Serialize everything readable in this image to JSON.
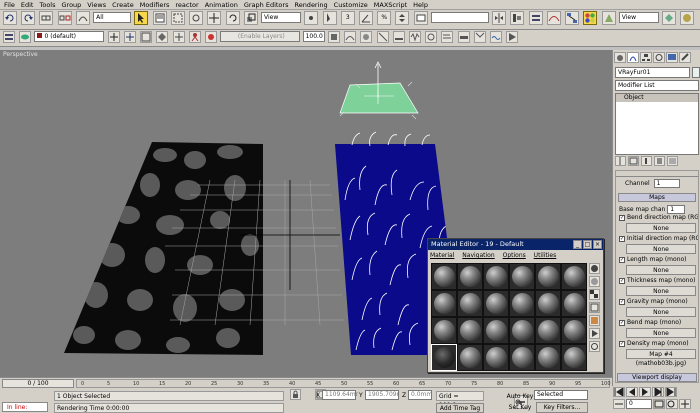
{
  "menu": [
    "File",
    "Edit",
    "Tools",
    "Group",
    "Views",
    "Create",
    "Modifiers",
    "reactor",
    "Animation",
    "Graph Editors",
    "Rendering",
    "Customize",
    "MAXScript",
    "Help"
  ],
  "toolbar": {
    "selection_filter": "All",
    "ref_coord": "View",
    "named_sel": "",
    "snap_view": "View",
    "layer": "0 (default)",
    "enable_layers": "(Enable Layers)",
    "percent": "100.0"
  },
  "viewport": {
    "label": "Perspective"
  },
  "colors": {
    "viewport_bg": "#7d7d7d",
    "blue_plane": "#0a0a8a",
    "gizmo": "#7fd19a",
    "active_yellow": "#f6d84a"
  },
  "material_editor": {
    "title": "Material Editor - 19 - Default",
    "menu": [
      "Material",
      "Navigation",
      "Options",
      "Utilities"
    ]
  },
  "command_panel": {
    "object_name": "VRayFur01",
    "modifier_list": "Modifier List",
    "stack_item": "Object",
    "channel_label": "Channel",
    "channel_value": "1",
    "maps_header": "Maps",
    "base_map_label": "Base map chan",
    "base_map_value": "1",
    "maps": [
      {
        "label": "Bend direction map (RGB)",
        "value": "None",
        "checked": true
      },
      {
        "label": "Initial direction map (RGB)",
        "value": "None",
        "checked": true
      },
      {
        "label": "Length map (mono)",
        "value": "None",
        "checked": true
      },
      {
        "label": "Thickness map (mono)",
        "value": "None",
        "checked": true
      },
      {
        "label": "Gravity map (mono)",
        "value": "None",
        "checked": true
      },
      {
        "label": "Bend map (mono)",
        "value": "None",
        "checked": true
      },
      {
        "label": "Density map (mono)",
        "value": "Map #4 (mathob03b.jpg)",
        "checked": true
      }
    ],
    "viewport_display": "Viewport display"
  },
  "status": {
    "frame_counter": "0 / 100",
    "ticks": [
      "0",
      "5",
      "10",
      "15",
      "20",
      "25",
      "30",
      "35",
      "40",
      "45",
      "50",
      "55",
      "60",
      "65",
      "70",
      "75",
      "80",
      "85",
      "90",
      "95",
      "100"
    ],
    "selected_text": "1 Object Selected",
    "render_time": "Rendering Time  0:00:00",
    "script_label": "In line:",
    "x_label": "X",
    "x_value": "1109.64mr",
    "y_label": "Y",
    "y_value": "1905.709r",
    "z_label": "Z",
    "z_value": "0.0mm",
    "grid": "Grid = 100.0mm",
    "add_time_tag": "Add Time Tag",
    "auto_key": "Auto Key",
    "selected_dropdown": "Selected",
    "set_key": "Set Key",
    "key_filters": "Key Filters...",
    "frame_field": "0"
  }
}
